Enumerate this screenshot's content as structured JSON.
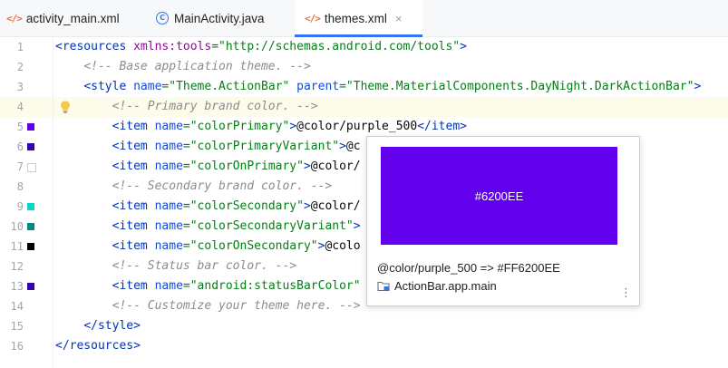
{
  "tabs": [
    {
      "label": "activity_main.xml",
      "icon": "xml-file-icon",
      "active": false
    },
    {
      "label": "MainActivity.java",
      "icon": "java-class-icon",
      "active": false
    },
    {
      "label": "themes.xml",
      "icon": "xml-file-icon",
      "active": true
    }
  ],
  "tab_close": "×",
  "gutter": {
    "line_numbers": [
      "1",
      "2",
      "3",
      "4",
      "5",
      "6",
      "7",
      "8",
      "9",
      "10",
      "11",
      "12",
      "13",
      "14",
      "15",
      "16"
    ],
    "swatches": [
      {
        "line": "5",
        "color": "#6200EE"
      },
      {
        "line": "6",
        "color": "#3700B3"
      },
      {
        "line": "7",
        "color": "#FFFFFF"
      },
      {
        "line": "9",
        "color": "#03DAC5"
      },
      {
        "line": "10",
        "color": "#018786"
      },
      {
        "line": "11",
        "color": "#000000"
      },
      {
        "line": "13",
        "color": "#3700B3"
      }
    ]
  },
  "code": {
    "l1": {
      "open": "<resources",
      "ns_attr": " xmlns:tools",
      "eq": "=",
      "val": "\"http://schemas.android.com/tools\"",
      "close": ">"
    },
    "l2": "<!-- Base application theme. -->",
    "l3": {
      "open": "<style",
      "a1": " name",
      "v1": "=\"Theme.ActionBar\"",
      "a2": " parent",
      "v2": "=\"Theme.MaterialComponents.DayNight.DarkActionBar\"",
      "close": ">"
    },
    "l4": "<!-- Primary brand color. -->",
    "l5": {
      "open": "<item",
      "attr": " name",
      "val": "=\"colorPrimary\"",
      "gt": ">",
      "text": "@color/purple_500",
      "end": "</item>"
    },
    "l6": {
      "open": "<item",
      "attr": " name",
      "val": "=\"colorPrimaryVariant\"",
      "gt": ">",
      "text": "@c"
    },
    "l7": {
      "open": "<item",
      "attr": " name",
      "val": "=\"colorOnPrimary\"",
      "gt": ">",
      "text": "@color/"
    },
    "l8": "<!-- Secondary brand color. -->",
    "l9": {
      "open": "<item",
      "attr": " name",
      "val": "=\"colorSecondary\"",
      "gt": ">",
      "text": "@color/"
    },
    "l10": {
      "open": "<item",
      "attr": " name",
      "val": "=\"colorSecondaryVariant\"",
      "gt": ">",
      "text": ""
    },
    "l11": {
      "open": "<item",
      "attr": " name",
      "val": "=\"colorOnSecondary\"",
      "gt": ">",
      "text": "@colo"
    },
    "l12": "<!-- Status bar color. -->",
    "l13": {
      "open": "<item",
      "attr": " name",
      "val": "=\"android:statusBarColor\"",
      "gt": "",
      "text": ""
    },
    "l14": "<!-- Customize your theme here. -->",
    "l15": "</style>",
    "l16": "</resources>"
  },
  "popup": {
    "swatch_color": "#6200EE",
    "swatch_label": "#6200EE",
    "description": "@color/purple_500 => #FF6200EE",
    "source": "ActionBar.app.main",
    "more": "⋮"
  },
  "colors": {
    "accent": "#3574F0",
    "tag": "#0033B3",
    "attribute": "#174AD4",
    "value": "#067D17",
    "comment": "#8C8C8C"
  }
}
